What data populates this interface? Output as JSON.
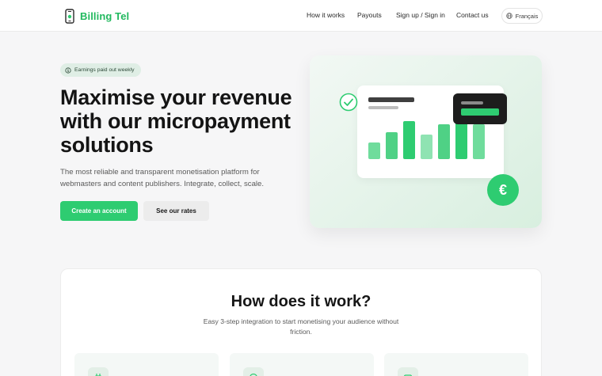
{
  "brand": {
    "name": "Billing Tel",
    "accent": "#22b95f"
  },
  "nav": {
    "links": [
      "How it works",
      "Payouts",
      "Sign up / Sign in",
      "Contact us"
    ],
    "language": "Français"
  },
  "hero": {
    "badge": "Earnings paid out weekly",
    "title": "Maximise your revenue with our micropayment solutions",
    "subtitle": "The most reliable and transparent monetisation platform for webmasters and content publishers. Integrate, collect, scale.",
    "primary_cta": "Create an account",
    "secondary_cta": "See our rates",
    "illustration": {
      "currency_symbol": "€",
      "bar_levels": [
        0.38,
        0.6,
        0.85,
        0.55,
        0.78,
        0.95,
        0.78
      ]
    }
  },
  "how": {
    "title": "How does it work?",
    "subtitle": "Easy 3-step integration to start monetising your audience without friction.",
    "steps": [
      {
        "icon": "plug-icon"
      },
      {
        "icon": "target-icon"
      },
      {
        "icon": "wallet-icon"
      }
    ]
  },
  "colors": {
    "primary": "#2ecc71",
    "dark": "#1d1d1d",
    "light_green": "#dfeee5"
  }
}
